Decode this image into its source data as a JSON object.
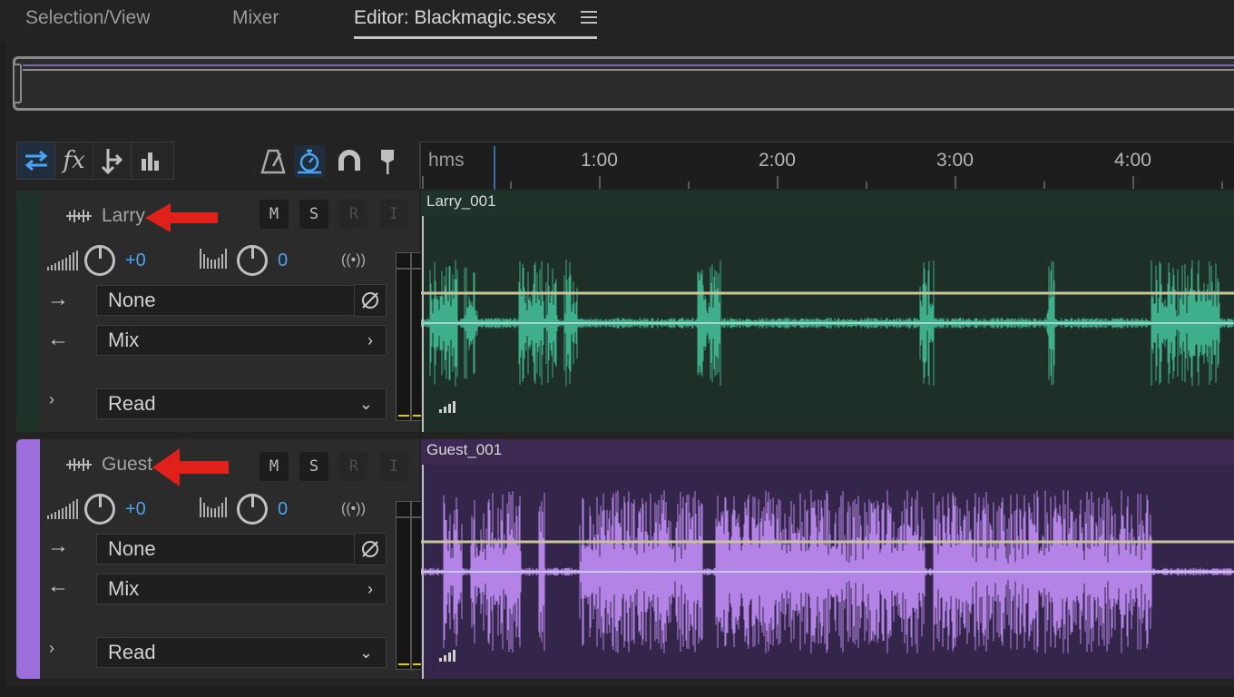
{
  "tabs": [
    {
      "label": "Selection/View"
    },
    {
      "label": "Mixer"
    },
    {
      "label": "Editor: Blackmagic.sesx"
    }
  ],
  "ruler": {
    "unit": "hms",
    "labels": [
      "1:00",
      "2:00",
      "3:00",
      "4:00"
    ]
  },
  "tracks": [
    {
      "name": "Larry",
      "clip": "Larry_001",
      "color": "#2c4a3d",
      "wave_color": "#3fae8a",
      "volume": "+0",
      "pan": "0",
      "input": "None",
      "output": "Mix",
      "automation": "Read"
    },
    {
      "name": "Guest",
      "clip": "Guest_001",
      "color": "#3c2a52",
      "wave_color": "#b384e6",
      "volume": "+0",
      "pan": "0",
      "input": "None",
      "output": "Mix",
      "automation": "Read"
    }
  ],
  "buttons": {
    "mute": "M",
    "solo": "S",
    "record": "R",
    "input_monitor": "I"
  }
}
